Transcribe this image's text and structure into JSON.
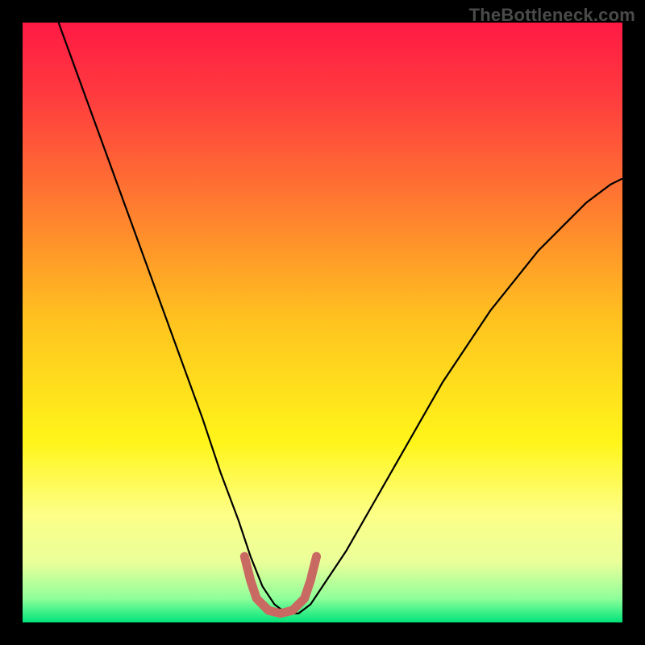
{
  "watermark": "TheBottleneck.com",
  "chart_data": {
    "type": "line",
    "title": "",
    "xlabel": "",
    "ylabel": "",
    "xlim": [
      0,
      100
    ],
    "ylim": [
      0,
      100
    ],
    "background_gradient": {
      "stops": [
        {
          "offset": 0.0,
          "color": "#ff1a44"
        },
        {
          "offset": 0.12,
          "color": "#ff3a3f"
        },
        {
          "offset": 0.3,
          "color": "#ff7a30"
        },
        {
          "offset": 0.5,
          "color": "#ffc41f"
        },
        {
          "offset": 0.7,
          "color": "#fff51a"
        },
        {
          "offset": 0.82,
          "color": "#fdff87"
        },
        {
          "offset": 0.9,
          "color": "#eaff9a"
        },
        {
          "offset": 0.96,
          "color": "#8fff9a"
        },
        {
          "offset": 1.0,
          "color": "#00e47a"
        }
      ]
    },
    "series": [
      {
        "name": "bottleneck-curve",
        "color": "#000000",
        "width": 2.2,
        "x": [
          6,
          10,
          14,
          18,
          22,
          26,
          30,
          33,
          36,
          38,
          40,
          42,
          44,
          46,
          48,
          50,
          54,
          58,
          62,
          66,
          70,
          74,
          78,
          82,
          86,
          90,
          94,
          98,
          100
        ],
        "values": [
          100,
          89,
          78,
          67,
          56,
          45,
          34,
          25,
          17,
          11,
          6,
          3,
          1.5,
          1.5,
          3,
          6,
          12,
          19,
          26,
          33,
          40,
          46,
          52,
          57,
          62,
          66,
          70,
          73,
          74
        ]
      },
      {
        "name": "optimal-zone-marker",
        "color": "#c96a62",
        "width": 11,
        "linecap": "round",
        "x": [
          37,
          38,
          39,
          41,
          43,
          45,
          47,
          48,
          49
        ],
        "values": [
          11,
          7,
          4,
          2,
          1.5,
          2,
          4,
          7,
          11
        ]
      }
    ]
  }
}
